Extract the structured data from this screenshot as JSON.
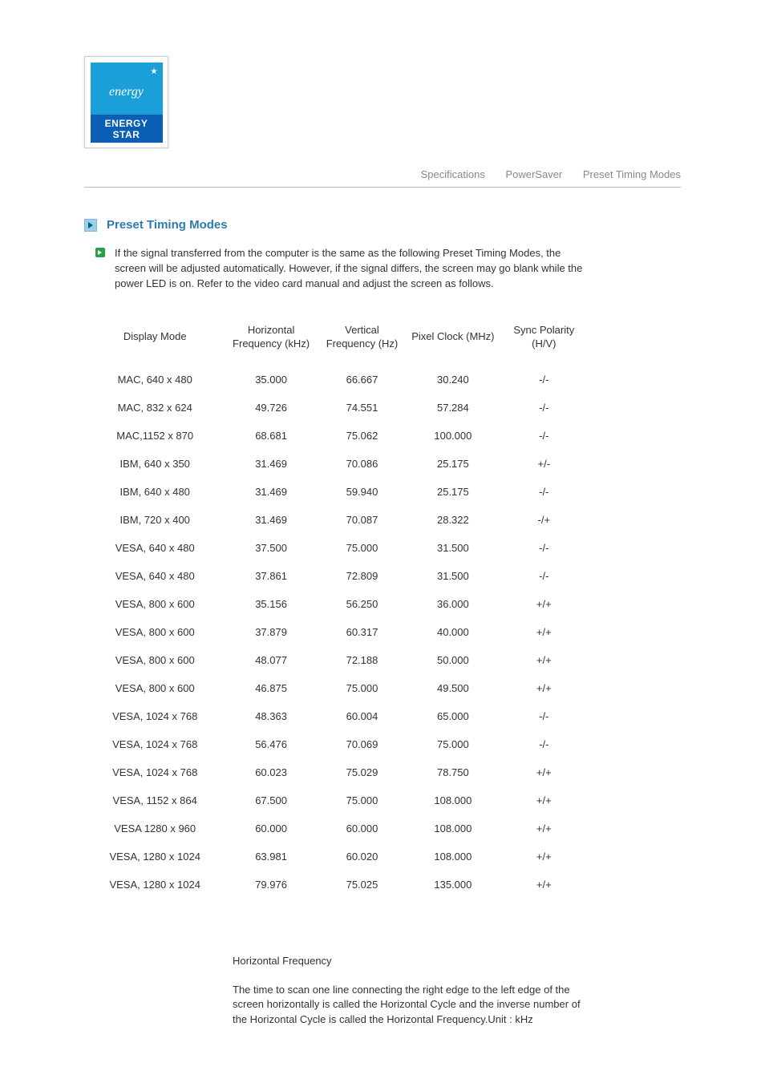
{
  "logo": {
    "label": "ENERGY STAR"
  },
  "tabs": [
    {
      "label": "Specifications"
    },
    {
      "label": "PowerSaver"
    },
    {
      "label": "Preset Timing Modes"
    }
  ],
  "section": {
    "heading": "Preset Timing Modes",
    "intro": "If the signal transferred from the computer is the same as the following Preset Timing Modes, the screen will be adjusted automatically. However, if the signal differs, the screen may go blank while the power LED is on. Refer to the video card manual and adjust the screen as follows."
  },
  "table": {
    "headers": {
      "c0": "Display Mode",
      "c1": "Horizontal Frequency (kHz)",
      "c2": "Vertical Frequency (Hz)",
      "c3": "Pixel Clock (MHz)",
      "c4": "Sync Polarity (H/V)"
    },
    "rows": [
      {
        "c0": "MAC, 640 x 480",
        "c1": "35.000",
        "c2": "66.667",
        "c3": "30.240",
        "c4": "-/-"
      },
      {
        "c0": "MAC, 832 x 624",
        "c1": "49.726",
        "c2": "74.551",
        "c3": "57.284",
        "c4": "-/-"
      },
      {
        "c0": "MAC,1152 x 870",
        "c1": "68.681",
        "c2": "75.062",
        "c3": "100.000",
        "c4": "-/-"
      },
      {
        "c0": "IBM, 640 x 350",
        "c1": "31.469",
        "c2": "70.086",
        "c3": "25.175",
        "c4": "+/-"
      },
      {
        "c0": "IBM, 640 x 480",
        "c1": "31.469",
        "c2": "59.940",
        "c3": "25.175",
        "c4": "-/-"
      },
      {
        "c0": "IBM, 720 x 400",
        "c1": "31.469",
        "c2": "70.087",
        "c3": "28.322",
        "c4": "-/+"
      },
      {
        "c0": "VESA, 640 x 480",
        "c1": "37.500",
        "c2": "75.000",
        "c3": "31.500",
        "c4": "-/-"
      },
      {
        "c0": "VESA, 640 x 480",
        "c1": "37.861",
        "c2": "72.809",
        "c3": "31.500",
        "c4": "-/-"
      },
      {
        "c0": "VESA, 800 x 600",
        "c1": "35.156",
        "c2": "56.250",
        "c3": "36.000",
        "c4": "+/+"
      },
      {
        "c0": "VESA, 800 x 600",
        "c1": "37.879",
        "c2": "60.317",
        "c3": "40.000",
        "c4": "+/+"
      },
      {
        "c0": "VESA, 800 x 600",
        "c1": "48.077",
        "c2": "72.188",
        "c3": "50.000",
        "c4": "+/+"
      },
      {
        "c0": "VESA, 800 x 600",
        "c1": "46.875",
        "c2": "75.000",
        "c3": "49.500",
        "c4": "+/+"
      },
      {
        "c0": "VESA, 1024 x 768",
        "c1": "48.363",
        "c2": "60.004",
        "c3": "65.000",
        "c4": "-/-"
      },
      {
        "c0": "VESA, 1024 x 768",
        "c1": "56.476",
        "c2": "70.069",
        "c3": "75.000",
        "c4": "-/-"
      },
      {
        "c0": "VESA, 1024 x 768",
        "c1": "60.023",
        "c2": "75.029",
        "c3": "78.750",
        "c4": "+/+"
      },
      {
        "c0": "VESA, 1152 x 864",
        "c1": "67.500",
        "c2": "75.000",
        "c3": "108.000",
        "c4": "+/+"
      },
      {
        "c0": "VESA 1280 x 960",
        "c1": "60.000",
        "c2": "60.000",
        "c3": "108.000",
        "c4": "+/+"
      },
      {
        "c0": "VESA, 1280 x 1024",
        "c1": "63.981",
        "c2": "60.020",
        "c3": "108.000",
        "c4": "+/+"
      },
      {
        "c0": "VESA, 1280 x 1024",
        "c1": "79.976",
        "c2": "75.025",
        "c3": "135.000",
        "c4": "+/+"
      }
    ]
  },
  "definitions": {
    "title": "Horizontal Frequency",
    "body": "The time to scan one line connecting the right edge to the left edge of the screen horizontally is called the Horizontal Cycle and the inverse number of the Horizontal Cycle is called the Horizontal Frequency.Unit : kHz"
  }
}
